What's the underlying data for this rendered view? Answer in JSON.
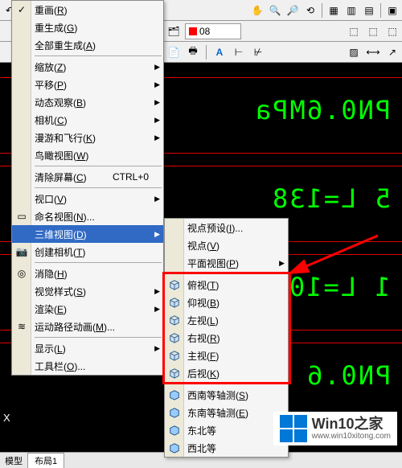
{
  "toolbar_top": {
    "buttons": [
      "undo",
      "redo",
      "dropdown",
      "dropdown",
      "cut",
      "sep",
      "zoom-realtime",
      "zoom-window",
      "zoom-prev",
      "pan",
      "sep",
      "props",
      "sheet",
      "layers",
      "tools",
      "sep",
      "block"
    ]
  },
  "toolbar_mid": {
    "layer": {
      "swatch": "#ff0000",
      "name": "08"
    }
  },
  "toolbar_bot": {
    "buttons": [
      "new",
      "open",
      "save",
      "sep",
      "annotate",
      "dim-linear",
      "dim-align",
      "sep",
      "hatch",
      "mtext",
      "dim"
    ]
  },
  "menu": {
    "items": [
      {
        "label": "重画",
        "key": "R",
        "icon": "check"
      },
      {
        "label": "重生成",
        "key": "G"
      },
      {
        "label": "全部重生成",
        "key": "A"
      },
      "sep",
      {
        "label": "缩放",
        "key": "Z",
        "sub": true
      },
      {
        "label": "平移",
        "key": "P",
        "sub": true
      },
      {
        "label": "动态观察",
        "key": "B",
        "sub": true
      },
      {
        "label": "相机",
        "key": "C",
        "sub": true
      },
      {
        "label": "漫游和飞行",
        "key": "K",
        "sub": true
      },
      {
        "label": "鸟瞰视图",
        "key": "W"
      },
      "sep",
      {
        "label": "清除屏幕",
        "key": "C",
        "shortcut": "CTRL+0"
      },
      "sep",
      {
        "label": "视口",
        "key": "V",
        "sub": true
      },
      {
        "label": "命名视图",
        "key": "N",
        "ell": true,
        "icon": "namedview"
      },
      {
        "label": "三维视图",
        "key": "D",
        "sub": true,
        "hi": true
      },
      {
        "label": "创建相机",
        "key": "T",
        "icon": "camera"
      },
      "sep",
      {
        "label": "消隐",
        "key": "H",
        "icon": "hide"
      },
      {
        "label": "视觉样式",
        "key": "S",
        "sub": true
      },
      {
        "label": "渲染",
        "key": "E",
        "sub": true
      },
      {
        "label": "运动路径动画",
        "key": "M",
        "ell": true,
        "icon": "motion"
      },
      "sep",
      {
        "label": "显示",
        "key": "L",
        "sub": true
      },
      {
        "label": "工具栏",
        "key": "O",
        "ell": true
      }
    ]
  },
  "submenu": {
    "items": [
      {
        "label": "视点预设",
        "key": "I",
        "ell": true
      },
      {
        "label": "视点",
        "key": "V"
      },
      {
        "label": "平面视图",
        "key": "P",
        "sub": true
      },
      "sep",
      {
        "label": "俯视",
        "key": "T",
        "icon": "cube-top"
      },
      {
        "label": "仰视",
        "key": "B",
        "icon": "cube-bottom"
      },
      {
        "label": "左视",
        "key": "L",
        "icon": "cube-left"
      },
      {
        "label": "右视",
        "key": "R",
        "icon": "cube-right"
      },
      {
        "label": "主视",
        "key": "F",
        "icon": "cube-front"
      },
      {
        "label": "后视",
        "key": "K",
        "icon": "cube-back"
      },
      "sep",
      {
        "label": "西南等轴测",
        "key": "S",
        "icon": "iso"
      },
      {
        "label": "东南等轴测",
        "key": "E",
        "icon": "iso"
      },
      {
        "label": "东北等",
        "icon": "iso"
      },
      {
        "label": "西北等",
        "icon": "iso"
      }
    ]
  },
  "canvas_text": {
    "t1": "PN0.6MPa",
    "t2": "5 L=138",
    "t3": "1 L=10",
    "t4": "PN0.6"
  },
  "tabs": {
    "model": "模型",
    "layout": "布局1",
    "xlabel": "X"
  },
  "watermark": {
    "title": "Win10之家",
    "url": "www.win10xitong.com"
  }
}
